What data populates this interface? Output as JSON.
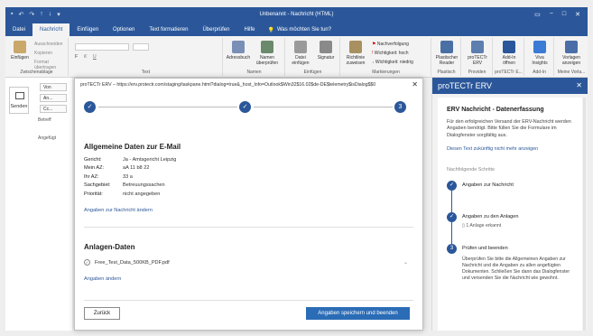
{
  "window": {
    "title": "Unbenannt - Nachricht (HTML)",
    "controls": [
      "▭",
      "−",
      "□",
      "✕"
    ]
  },
  "tabs": [
    {
      "label": "Datei"
    },
    {
      "label": "Nachricht"
    },
    {
      "label": "Einfügen"
    },
    {
      "label": "Optionen"
    },
    {
      "label": "Text formatieren"
    },
    {
      "label": "Überprüfen"
    },
    {
      "label": "Hilfe"
    }
  ],
  "tellme": "Was möchten Sie tun?",
  "ribbon": {
    "clipboard": {
      "paste": "Einfügen",
      "cut": "Ausschneiden",
      "copy": "Kopieren",
      "format": "Format übertragen",
      "label": "Zwischenablage"
    },
    "text_label": "Text",
    "names": {
      "address": "Adressbuch",
      "check": "Namen überprüfen",
      "label": "Namen"
    },
    "insert": {
      "file": "Datei einfügen",
      "signature": "Signatur",
      "label": "Einfügen"
    },
    "tags": {
      "policy": "Richtlinie zuweisen",
      "followup": "Nachverfolgung",
      "high": "Wichtigkeit: hoch",
      "low": "Wichtigkeit: niedrig",
      "label": "Markierungen"
    },
    "addins": [
      {
        "label": "Plastischer Reader",
        "group": "Plastisch"
      },
      {
        "label": "proTECTr ERV",
        "group": "Providen"
      },
      {
        "label": "Add-In öffnen",
        "group": "proTECTr E..."
      },
      {
        "label": "Viva Insights",
        "group": "Add-In"
      },
      {
        "label": "Vorlagen anzeigen",
        "group": "Meine Vorla..."
      }
    ]
  },
  "compose": {
    "send": "Senden",
    "from": "Von",
    "to": "An...",
    "cc": "Cc...",
    "subject": "Betreff",
    "attached": "Angefügt"
  },
  "dialog": {
    "title": "proTECTr ERV – https://erv.protectr.com/staging/taskpane.html?dialog=true&_host_Info=Outlook$Win32$16.02$de-DE$telemetry$isDialog$$0",
    "close": "✕",
    "steps": [
      "✓",
      "✓",
      "3"
    ],
    "general": {
      "heading": "Allgemeine Daten zur E-Mail",
      "rows": [
        {
          "k": "Gericht:",
          "v": "Ja - Amtsgericht Leipzig"
        },
        {
          "k": "Mein AZ:",
          "v": "aA 11 b8 22"
        },
        {
          "k": "Ihr AZ:",
          "v": "33 a"
        },
        {
          "k": "Sachgebiet:",
          "v": "Betreuungssachen"
        },
        {
          "k": "Priorität:",
          "v": "nicht angegeben"
        }
      ],
      "link": "Angaben zur Nachricht ändern"
    },
    "attachments": {
      "heading": "Anlagen-Daten",
      "file": "Free_Test_Data_500KB_PDF.pdf",
      "link": "Angaben ändern"
    },
    "back": "Zurück",
    "save": "Angaben speichern und beenden"
  },
  "pane": {
    "header": "proTECTr ERV",
    "close": "✕",
    "title": "ERV Nachricht - Datenerfassung",
    "intro": "Für den erfolgreichen Versand der ERV-Nachricht werden Angaben benötigt. Bitte füllen Sie die Formulare im Dialogfenster sorgfältig aus.",
    "hide_link": "Diesen Text zukünftig nicht mehr anzeigen",
    "next_steps": "Nachfolgende Schritte",
    "steps": [
      {
        "mark": "✓",
        "label": "Angaben zur Nachricht"
      },
      {
        "mark": "✓",
        "label": "Angaben zu den Anlagen",
        "sub": "1 Anlage erkannt"
      },
      {
        "mark": "3",
        "label": "Prüfen und beenden",
        "desc": "Überprüfen Sie bitte die Allgemeinen Angaben zur Nachricht und die Angaben zu allen angefügten Dokumenten. Schließen Sie dann das Dialogfenster und versenden Sie die Nachricht wie gewohnt."
      }
    ]
  }
}
